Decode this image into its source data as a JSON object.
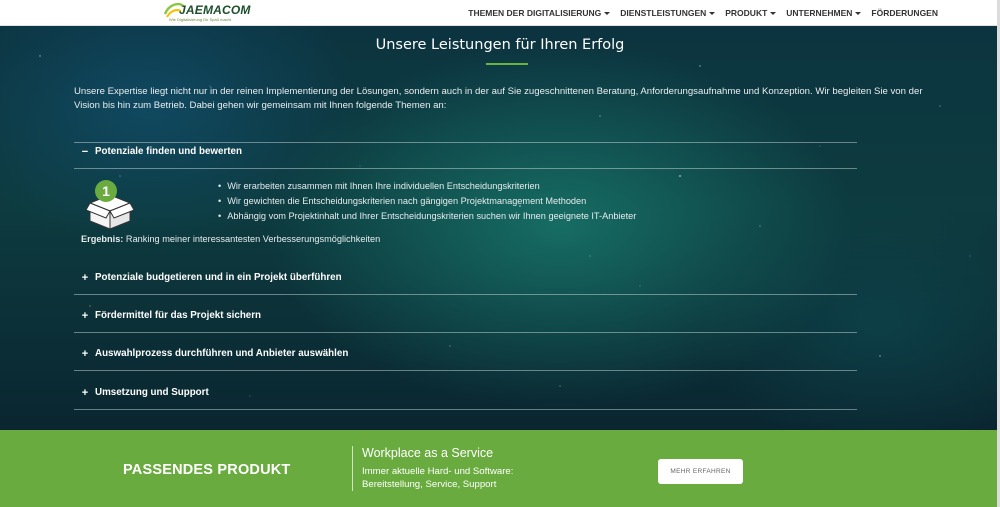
{
  "header": {
    "logo_text": "JAEMACOM",
    "logo_tagline": "Wie Digitalisierung Dir Spaß macht",
    "nav": [
      {
        "label": "THEMEN DER DIGITALISIERUNG",
        "has_dropdown": true
      },
      {
        "label": "DIENSTLEISTUNGEN",
        "has_dropdown": true
      },
      {
        "label": "PRODUKT",
        "has_dropdown": true
      },
      {
        "label": "UNTERNEHMEN",
        "has_dropdown": true
      },
      {
        "label": "FÖRDERUNGEN",
        "has_dropdown": false
      }
    ]
  },
  "section": {
    "title": "Unsere Leistungen für Ihren Erfolg",
    "intro": "Unsere Expertise liegt nicht nur in der reinen Implementierung der Lösungen, sondern auch in der auf Sie zugeschnittenen Beratung, Anforderungsaufnahme und Konzeption. Wir begleiten Sie von der Vision bis hin zum Betrieb. Dabei gehen wir gemeinsam mit Ihnen folgende Themen an:",
    "accordion": [
      {
        "sign": "−",
        "label": "Potenziale finden und bewerten",
        "expanded": true
      },
      {
        "sign": "+",
        "label": "Potenziale budgetieren und in ein Projekt überführen",
        "expanded": false
      },
      {
        "sign": "+",
        "label": "Fördermittel für das Projekt sichern",
        "expanded": false
      },
      {
        "sign": "+",
        "label": "Auswahlprozess durchführen und Anbieter auswählen",
        "expanded": false
      },
      {
        "sign": "+",
        "label": "Umsetzung und Support",
        "expanded": false
      }
    ],
    "expanded_content": {
      "step_number": "1",
      "bullets": [
        "Wir erarbeiten zusammen mit Ihnen Ihre individuellen Entscheidungskriterien",
        "Wir gewichten die Entscheidungskriterien nach gängigen Projektmanagement Methoden",
        "Abhängig vom Projektinhalt und Ihrer Entscheidungskriterien suchen wir Ihnen geeignete IT-Anbieter"
      ],
      "result_label": "Ergebnis:",
      "result_text": " Ranking meiner interessantesten Verbesserungsmöglichkeiten"
    }
  },
  "promo": {
    "title": "PASSENDES PRODUKT",
    "product_name": "Workplace as a Service",
    "desc_line1": "Immer aktuelle Hard- und Software:",
    "desc_line2": "Bereitstellung, Service, Support",
    "button_label": "MEHR ERFAHREN"
  },
  "colors": {
    "accent_green": "#6aab3f",
    "header_bg": "#ffffff",
    "text_light": "#ffffff"
  },
  "icons": [
    "logo-icon",
    "caret-down-icon",
    "minus-icon",
    "plus-icon",
    "open-box-icon"
  ]
}
